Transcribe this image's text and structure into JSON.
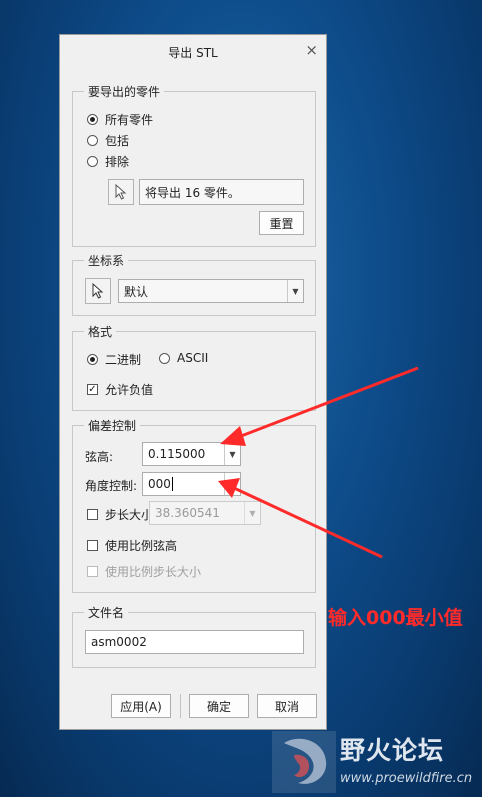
{
  "dialog": {
    "title": "导出 STL",
    "close_glyph": "×"
  },
  "parts_group": {
    "title": "要导出的零件",
    "options": [
      {
        "label": "所有零件",
        "selected": true
      },
      {
        "label": "包括",
        "selected": false
      },
      {
        "label": "排除",
        "selected": false
      }
    ],
    "info_text": "将导出 16 零件。",
    "reset_label": "重置"
  },
  "coord_group": {
    "title": "坐标系",
    "select_value": "默认"
  },
  "format_group": {
    "title": "格式",
    "binary_label": "二进制",
    "ascii_label": "ASCII",
    "binary_selected": true,
    "allow_negative_label": "允许负值",
    "allow_negative_checked": true
  },
  "deviation_group": {
    "title": "偏差控制",
    "chord_label": "弦高:",
    "chord_value": "0.115000",
    "angle_label": "角度控制:",
    "angle_value": "000",
    "step_label": "步长大小:",
    "step_value": "38.360541",
    "ratio_chord_label": "使用比例弦高",
    "ratio_step_label": "使用比例步长大小"
  },
  "filename_group": {
    "title": "文件名",
    "value": "asm0002"
  },
  "buttons": {
    "apply": "应用(A)",
    "ok": "确定",
    "cancel": "取消"
  },
  "annotation": {
    "text": "输入000最小值",
    "color": "#ff2a2a"
  },
  "watermark": {
    "title": "野火论坛",
    "url": "www.proewildfire.cn"
  }
}
